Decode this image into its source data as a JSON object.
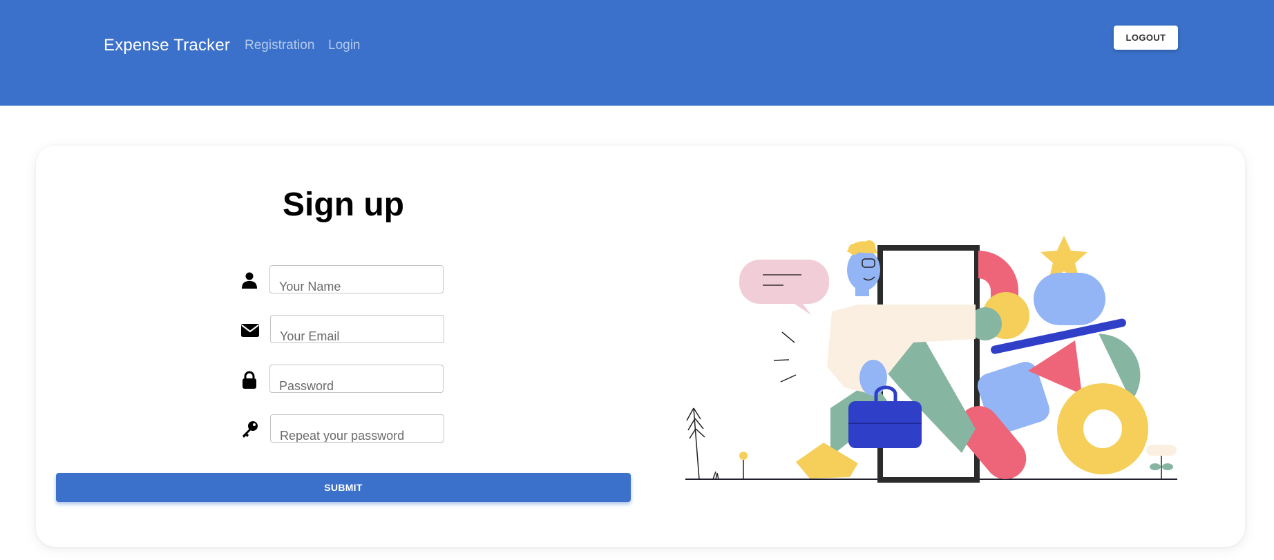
{
  "navbar": {
    "brand": "Expense Tracker",
    "links": [
      "Registration",
      "Login"
    ],
    "logout_label": "LOGOUT"
  },
  "form": {
    "title": "Sign up",
    "fields": [
      {
        "icon": "person-icon",
        "placeholder": "Your Name"
      },
      {
        "icon": "envelope-icon",
        "placeholder": "Your Email"
      },
      {
        "icon": "lock-icon",
        "placeholder": "Password"
      },
      {
        "icon": "key-icon",
        "placeholder": "Repeat your password"
      }
    ],
    "submit_label": "SUBMIT"
  },
  "colors": {
    "primary": "#3b71ca",
    "illustration_yellow": "#f5cf5a",
    "illustration_pink": "#ee6478",
    "illustration_blue": "#93b5f5",
    "illustration_green": "#86b5a2",
    "illustration_navy": "#2f3fc8"
  },
  "illustration": {
    "description_icon": "man-opening-door-with-shapes-illustration"
  }
}
